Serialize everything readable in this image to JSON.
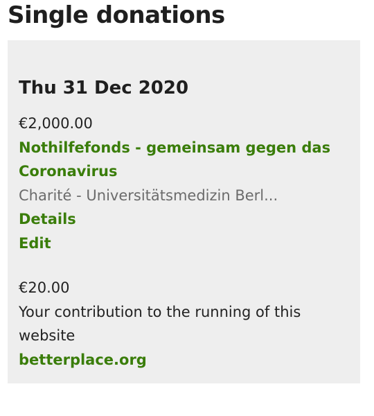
{
  "page_title": "Single donations",
  "donation_group": {
    "date": "Thu 31 Dec 2020",
    "donations": [
      {
        "amount": "€2,000.00",
        "project_line1": "Nothilfefonds - gemeinsam gegen das",
        "project_line2": "Coronavirus",
        "organisation": "Charité - Universitätsmedizin Berl...",
        "details_label": "Details",
        "edit_label": "Edit"
      },
      {
        "amount": "€20.00",
        "description_line1": "Your contribution to the running of this",
        "description_line2": "website",
        "link_label": "betterplace.org"
      }
    ]
  },
  "colors": {
    "link_green": "#3a7d0a",
    "card_background": "#eeeeee",
    "muted_text": "#6b6b6b"
  }
}
